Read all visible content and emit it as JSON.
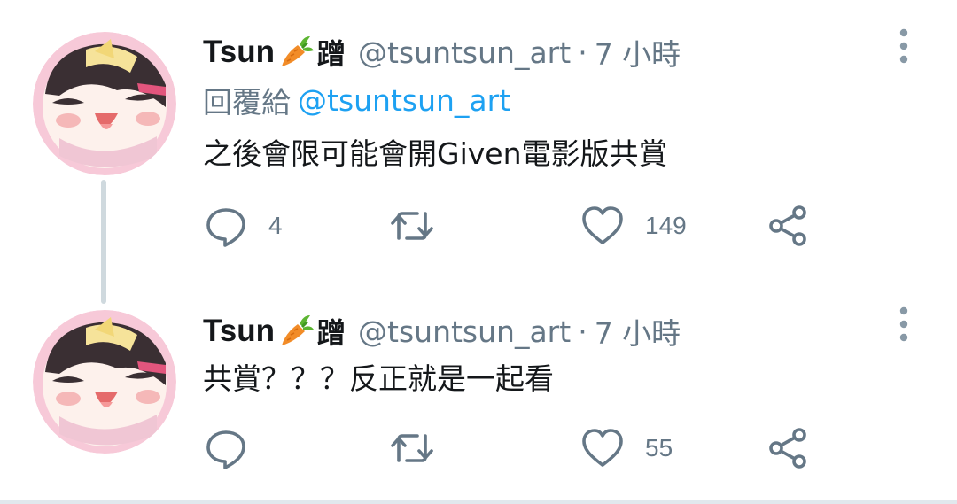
{
  "tweets": [
    {
      "display_name": "Tsun",
      "name_suffix": "蹭",
      "handle": "@tsuntsun_art",
      "separator": "·",
      "time": "7 小時",
      "reply_prefix": "回覆給",
      "reply_mention": "@tsuntsun_art",
      "text": "之後會限可能會開Given電影版共賞",
      "reply_count": "4",
      "retweet_count": "",
      "like_count": "149"
    },
    {
      "display_name": "Tsun",
      "name_suffix": "蹭",
      "handle": "@tsuntsun_art",
      "separator": "·",
      "time": "7 小時",
      "text": "共賞？？？反正就是一起看",
      "reply_count": "",
      "retweet_count": "",
      "like_count": "55"
    }
  ],
  "icons": {
    "name_emoji": "carrot-icon",
    "reply": "reply-icon",
    "retweet": "retweet-icon",
    "like": "heart-icon",
    "share": "share-icon",
    "more": "more-vertical-icon"
  },
  "colors": {
    "text_primary": "#14171a",
    "text_secondary": "#657786",
    "link": "#1da1f2",
    "thread_line": "#cfd9de",
    "icon_gray": "#657786",
    "avatar_ring": "#f4b8cc"
  }
}
